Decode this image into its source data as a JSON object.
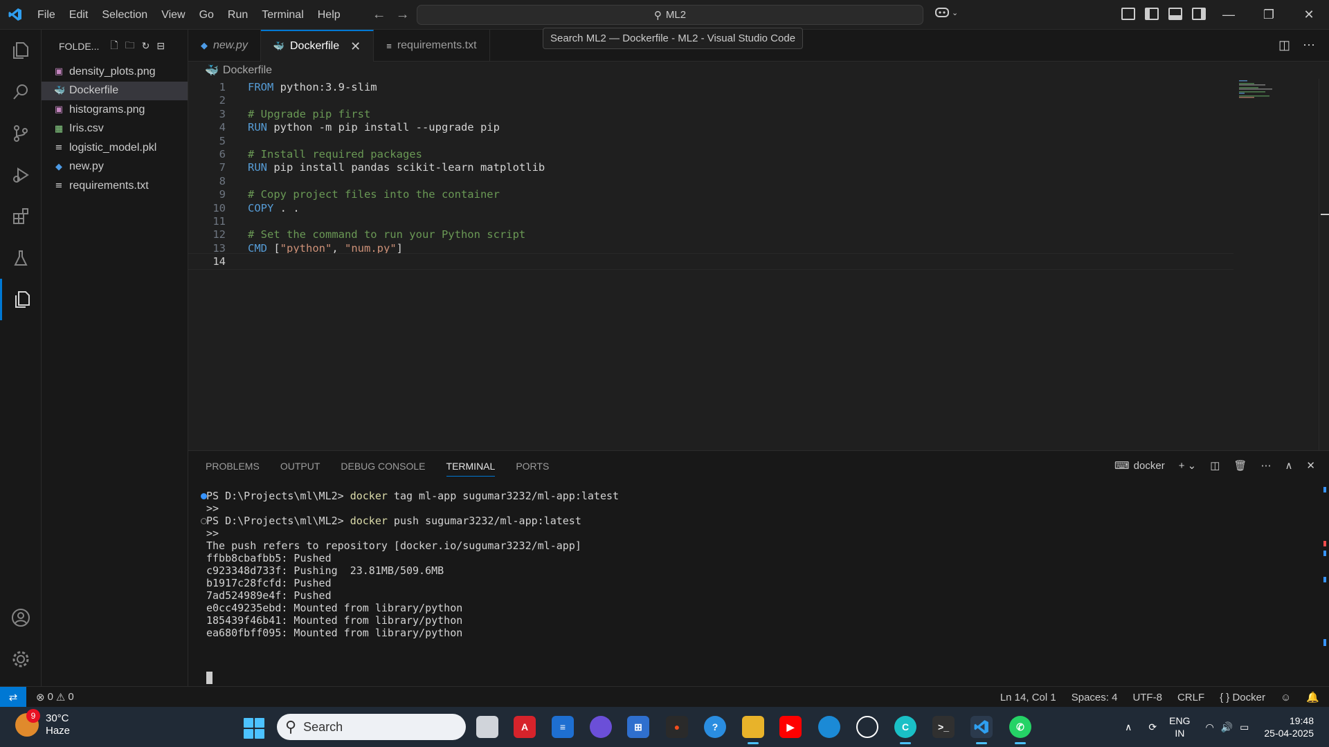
{
  "menu": [
    "File",
    "Edit",
    "Selection",
    "View",
    "Go",
    "Run",
    "Terminal",
    "Help"
  ],
  "command_center": "ML2",
  "tooltip": "Search ML2 — Dockerfile - ML2 - Visual Studio Code",
  "sidebar": {
    "title": "FOLDE...",
    "files": [
      {
        "name": "density_plots.png",
        "icon": "image-icon",
        "color": "#c586c0"
      },
      {
        "name": "Dockerfile",
        "icon": "docker-icon",
        "color": "#4d9be6",
        "selected": true
      },
      {
        "name": "histograms.png",
        "icon": "image-icon",
        "color": "#c586c0"
      },
      {
        "name": "Iris.csv",
        "icon": "table-icon",
        "color": "#89d185"
      },
      {
        "name": "logistic_model.pkl",
        "icon": "lines-icon",
        "color": "#cccccc"
      },
      {
        "name": "new.py",
        "icon": "python-icon",
        "color": "#4d9be6"
      },
      {
        "name": "requirements.txt",
        "icon": "lines-icon",
        "color": "#cccccc"
      }
    ]
  },
  "tabs": [
    {
      "label": "new.py",
      "icon": "python-icon",
      "active": false
    },
    {
      "label": "Dockerfile",
      "icon": "docker-icon",
      "active": true
    },
    {
      "label": "requirements.txt",
      "icon": "lines-icon",
      "active": false
    }
  ],
  "breadcrumb": "Dockerfile",
  "editor_lines": [
    {
      "n": "1",
      "parts": [
        [
          "kw",
          "FROM"
        ],
        [
          "pl",
          " python:3.9-slim"
        ]
      ]
    },
    {
      "n": "2",
      "parts": []
    },
    {
      "n": "3",
      "parts": [
        [
          "cm",
          "# Upgrade pip first"
        ]
      ]
    },
    {
      "n": "4",
      "parts": [
        [
          "kw",
          "RUN"
        ],
        [
          "pl",
          " python -m pip install --upgrade pip"
        ]
      ]
    },
    {
      "n": "5",
      "parts": []
    },
    {
      "n": "6",
      "parts": [
        [
          "cm",
          "# Install required packages"
        ]
      ]
    },
    {
      "n": "7",
      "parts": [
        [
          "kw",
          "RUN"
        ],
        [
          "pl",
          " pip install pandas scikit-learn matplotlib"
        ]
      ]
    },
    {
      "n": "8",
      "parts": []
    },
    {
      "n": "9",
      "parts": [
        [
          "cm",
          "# Copy project files into the container"
        ]
      ]
    },
    {
      "n": "10",
      "parts": [
        [
          "kw",
          "COPY"
        ],
        [
          "pl",
          " . ."
        ]
      ]
    },
    {
      "n": "11",
      "parts": []
    },
    {
      "n": "12",
      "parts": [
        [
          "cm",
          "# Set the command to run your Python script"
        ]
      ]
    },
    {
      "n": "13",
      "parts": [
        [
          "kw",
          "CMD"
        ],
        [
          "pl",
          " ["
        ],
        [
          "str",
          "\"python\""
        ],
        [
          "pl",
          ", "
        ],
        [
          "str",
          "\"num.py\""
        ],
        [
          "pl",
          "]"
        ]
      ]
    },
    {
      "n": "14",
      "parts": [],
      "current": true
    }
  ],
  "panel": {
    "tabs": [
      "PROBLEMS",
      "OUTPUT",
      "DEBUG CONSOLE",
      "TERMINAL",
      "PORTS"
    ],
    "active_tab": "TERMINAL",
    "terminal_name": "docker",
    "lines": [
      {
        "dot": "#3794ff",
        "parts": [
          [
            "pl",
            "PS D:\\Projects\\ml\\ML2> "
          ],
          [
            "yel",
            "docker"
          ],
          [
            "pl",
            " tag ml-app sugumar3232/ml-app:latest"
          ]
        ]
      },
      {
        "parts": [
          [
            "pl",
            ">>"
          ]
        ]
      },
      {
        "dot": "hollow",
        "parts": [
          [
            "pl",
            "PS D:\\Projects\\ml\\ML2> "
          ],
          [
            "yel",
            "docker"
          ],
          [
            "pl",
            " push sugumar3232/ml-app:latest"
          ]
        ]
      },
      {
        "parts": [
          [
            "pl",
            ">>"
          ]
        ]
      },
      {
        "parts": [
          [
            "pl",
            "The push refers to repository [docker.io/sugumar3232/ml-app]"
          ]
        ]
      },
      {
        "parts": [
          [
            "pl",
            "ffbb8cbafbb5: Pushed"
          ]
        ]
      },
      {
        "parts": [
          [
            "pl",
            "c923348d733f: Pushing  23.81MB/509.6MB"
          ]
        ]
      },
      {
        "parts": [
          [
            "pl",
            "b1917c28fcfd: Pushed"
          ]
        ]
      },
      {
        "parts": [
          [
            "pl",
            "7ad524989e4f: Pushed"
          ]
        ]
      },
      {
        "parts": [
          [
            "pl",
            "e0cc49235ebd: Mounted from library/python"
          ]
        ]
      },
      {
        "parts": [
          [
            "pl",
            "185439f46b41: Mounted from library/python"
          ]
        ]
      },
      {
        "parts": [
          [
            "pl",
            "ea680fbff095: Mounted from library/python"
          ]
        ]
      }
    ]
  },
  "status": {
    "errors": "0",
    "warnings": "0",
    "cursor": "Ln 14, Col 1",
    "spaces": "Spaces: 4",
    "encoding": "UTF-8",
    "eol": "CRLF",
    "language": "Docker"
  },
  "taskbar": {
    "temp": "30°C",
    "weather": "Haze",
    "weather_badge": "9",
    "search": "Search",
    "lang1": "ENG",
    "lang2": "IN",
    "time": "19:48",
    "date": "25-04-2025"
  }
}
